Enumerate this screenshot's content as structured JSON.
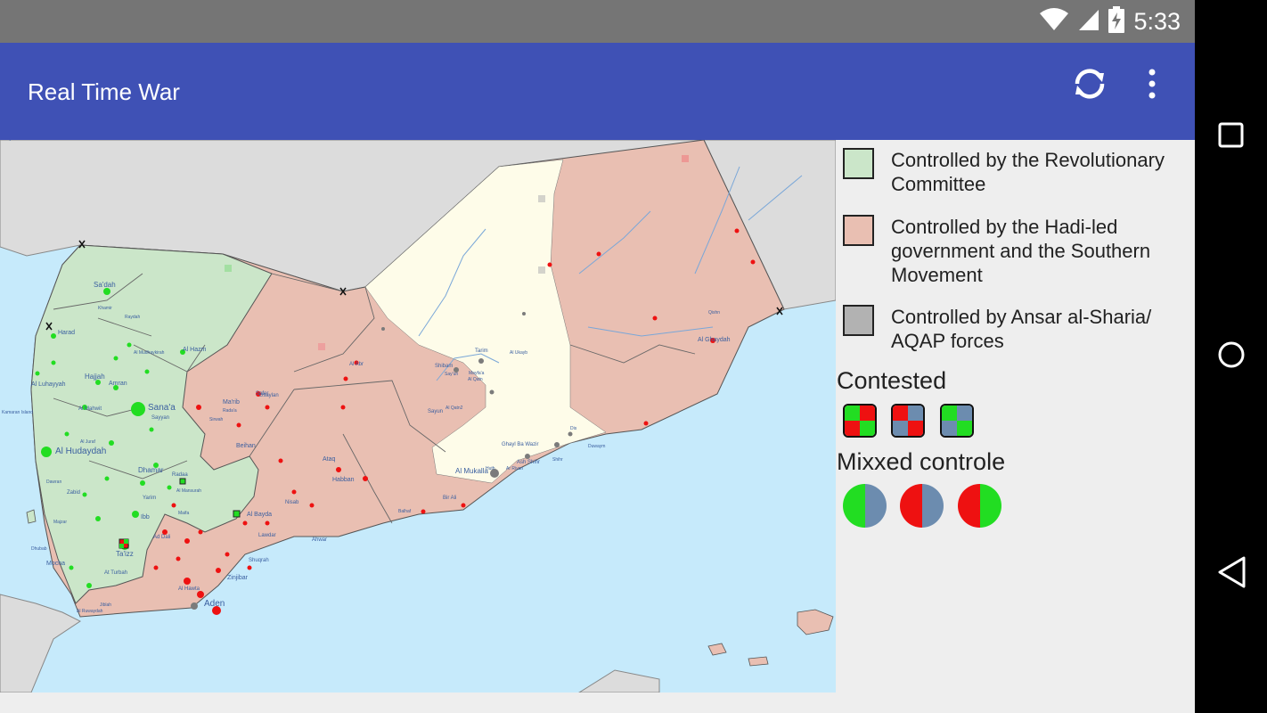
{
  "status": {
    "time": "5:33",
    "icons": [
      "wifi-icon",
      "cellular-icon",
      "battery-charging-icon"
    ]
  },
  "app": {
    "title": "Real Time War",
    "actions": [
      "refresh-icon",
      "overflow-menu-icon"
    ]
  },
  "colors": {
    "appbar": "#3f51b5",
    "revolutionary": "#cbe6c9",
    "hadi": "#e9bfb2",
    "aqap": "#b2b2b2",
    "unclaimed": "#fefce9",
    "sea": "#c6eafb",
    "neighbors": "#dcdcdc",
    "green_marker": "#22dd22",
    "red_marker": "#ee1111",
    "grey_marker": "#7b7b7b",
    "slate": "#6c8caf"
  },
  "legend": {
    "items": [
      {
        "label": "Controlled by the Revolutionary Committee",
        "color": "#cbe6c9"
      },
      {
        "label": "Controlled by the Hadi-led government and the Southern Movement",
        "color": "#e9bfb2"
      },
      {
        "label": "Controlled by Ansar al-Sharia/ AQAP forces",
        "color": "#b2b2b2"
      }
    ],
    "contested_title": "Contested",
    "contested_icons": [
      [
        "#22dd22",
        "#ee1111",
        "#ee1111",
        "#22dd22"
      ],
      [
        "#ee1111",
        "#6c8caf",
        "#6c8caf",
        "#ee1111"
      ],
      [
        "#22dd22",
        "#6c8caf",
        "#6c8caf",
        "#22dd22"
      ]
    ],
    "mixed_title": "Mixxed controle",
    "mixed_icons": [
      [
        "#22dd22",
        "#6c8caf"
      ],
      [
        "#ee1111",
        "#6c8caf"
      ],
      [
        "#ee1111",
        "#22dd22"
      ]
    ]
  },
  "map": {
    "cities": [
      "Sa'dah",
      "Harad",
      "Al Luhayyah",
      "Kamaran Island",
      "Hajjah",
      "Amran",
      "Al Hazm",
      "Sana'a",
      "Al Mahwit",
      "Sayyan",
      "Ma'rib",
      "Al Hudaydah",
      "Dhamar",
      "Zabid",
      "Yarim",
      "Ibb",
      "Mocha",
      "Ta'izz",
      "At Turbah",
      "Ad Dali",
      "Al Bayda",
      "Lawdar",
      "Zinjibar",
      "Aden",
      "Al Hawta",
      "Ataq",
      "Habban",
      "Al Abr",
      "Shibam",
      "Sayun",
      "Tarim",
      "Al Mukalla",
      "Ghayl Ba Wazir",
      "Ash Shihr",
      "Al Ghaydah",
      "Usaylan",
      "Safer",
      "Beihan",
      "Radaa",
      "Nisab",
      "Ahwar",
      "Shuqrah",
      "Jiblah",
      "Bir Ali",
      "Al Ruwaydah",
      "Mayfa'a",
      "Balhaf",
      "Qishn",
      "Dhubab",
      "Majzar",
      "Sirwah",
      "Al Juraf",
      "Al Mansurah",
      "Raydah",
      "Khamir",
      "Dawran",
      "Maifa",
      "Al Qatn",
      "Shihr",
      "Dis",
      "Duwaym",
      "Huth",
      "Ar Riyan",
      "Al Ukayb",
      "Say'un",
      "Al Qatn2",
      "Rada'a",
      "Al Mudhaykirah",
      "Buraym"
    ]
  }
}
